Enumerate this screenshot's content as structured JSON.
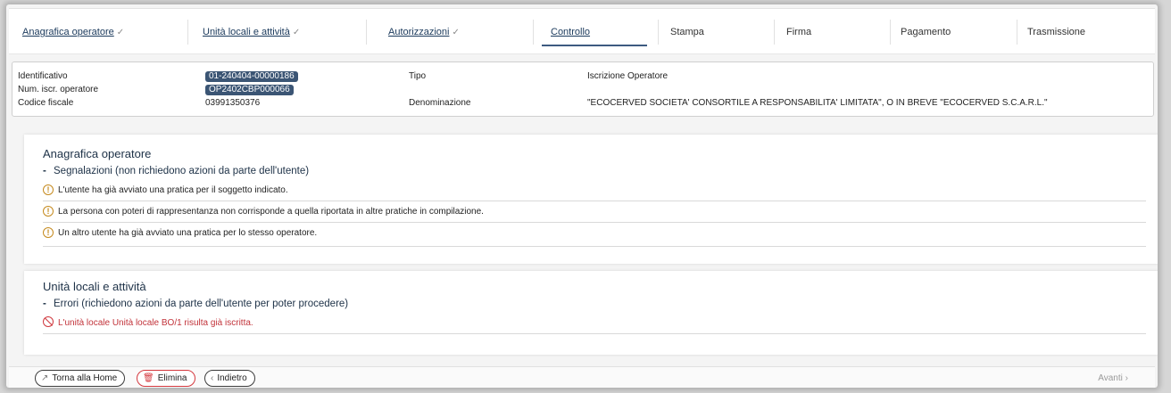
{
  "steps": [
    {
      "label": "Anagrafica operatore",
      "state": "done"
    },
    {
      "label": "Unità locali e attività",
      "state": "done"
    },
    {
      "label": "Autorizzazioni",
      "state": "done"
    },
    {
      "label": "Controllo",
      "state": "active"
    },
    {
      "label": "Stampa",
      "state": "todo"
    },
    {
      "label": "Firma",
      "state": "todo"
    },
    {
      "label": "Pagamento",
      "state": "todo"
    },
    {
      "label": "Trasmissione",
      "state": "todo"
    }
  ],
  "info": {
    "identificativo_label": "Identificativo",
    "identificativo_value": "01-240404-00000186",
    "num_iscr_label": "Num. iscr. operatore",
    "num_iscr_value": "OP2402CBP000066",
    "codice_fiscale_label": "Codice fiscale",
    "codice_fiscale_value": "03991350376",
    "tipo_label": "Tipo",
    "tipo_value": "Iscrizione Operatore",
    "denominazione_label": "Denominazione",
    "denominazione_value": "\"ECOCERVED SOCIETA' CONSORTILE A RESPONSABILITA' LIMITATA\", O IN BREVE \"ECOCERVED S.C.A.R.L.\""
  },
  "section1": {
    "title": "Anagrafica operatore",
    "subtitle": "Segnalazioni (non richiedono azioni da parte dell'utente)",
    "messages": [
      "L'utente ha già avviato una pratica per il soggetto indicato.",
      "La persona con poteri di rappresentanza non corrisponde a quella riportata in altre pratiche in compilazione.",
      "Un altro utente ha già avviato una pratica per lo stesso operatore."
    ]
  },
  "section2": {
    "title": "Unità locali e attività",
    "subtitle": "Errori (richiedono azioni da parte dell'utente per poter procedere)",
    "messages": [
      "L'unità locale Unità locale BO/1 risulta già iscritta."
    ]
  },
  "footer": {
    "home_label": "Torna alla Home",
    "delete_label": "Elimina",
    "back_label": "Indietro",
    "next_label": "Avanti"
  },
  "colors": {
    "accent": "#3d5a80",
    "badge": "#3b5574",
    "warning": "#c58a1e",
    "error": "#d0393f"
  }
}
